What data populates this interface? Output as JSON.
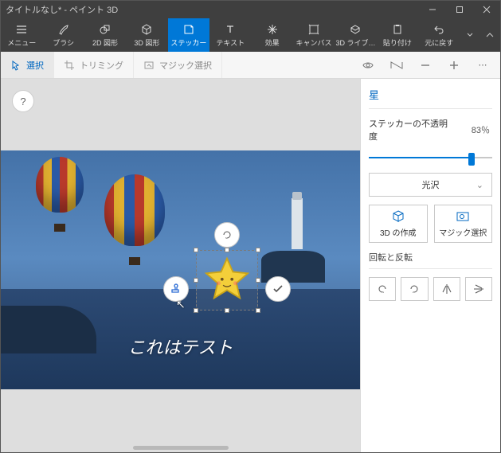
{
  "titlebar": {
    "title": "タイトルなし* - ペイント 3D"
  },
  "toolbar": {
    "items": [
      {
        "label": "メニュー"
      },
      {
        "label": "ブラシ"
      },
      {
        "label": "2D 図形"
      },
      {
        "label": "3D 図形"
      },
      {
        "label": "ステッカー"
      },
      {
        "label": "テキスト"
      },
      {
        "label": "効果"
      },
      {
        "label": "キャンバス"
      },
      {
        "label": "3D ライブ…"
      },
      {
        "label": "貼り付け"
      },
      {
        "label": "元に戻す"
      }
    ]
  },
  "secbar": {
    "select": "選択",
    "trim": "トリミング",
    "magic": "マジック選択"
  },
  "canvas": {
    "help": "?",
    "caption": "これはテスト"
  },
  "panel": {
    "title": "星",
    "opacity_label": "ステッカーの不透明度",
    "opacity_value": "83％",
    "finish": "光沢",
    "make3d": "3D の作成",
    "magic": "マジック選択",
    "rotate_label": "回転と反転"
  }
}
